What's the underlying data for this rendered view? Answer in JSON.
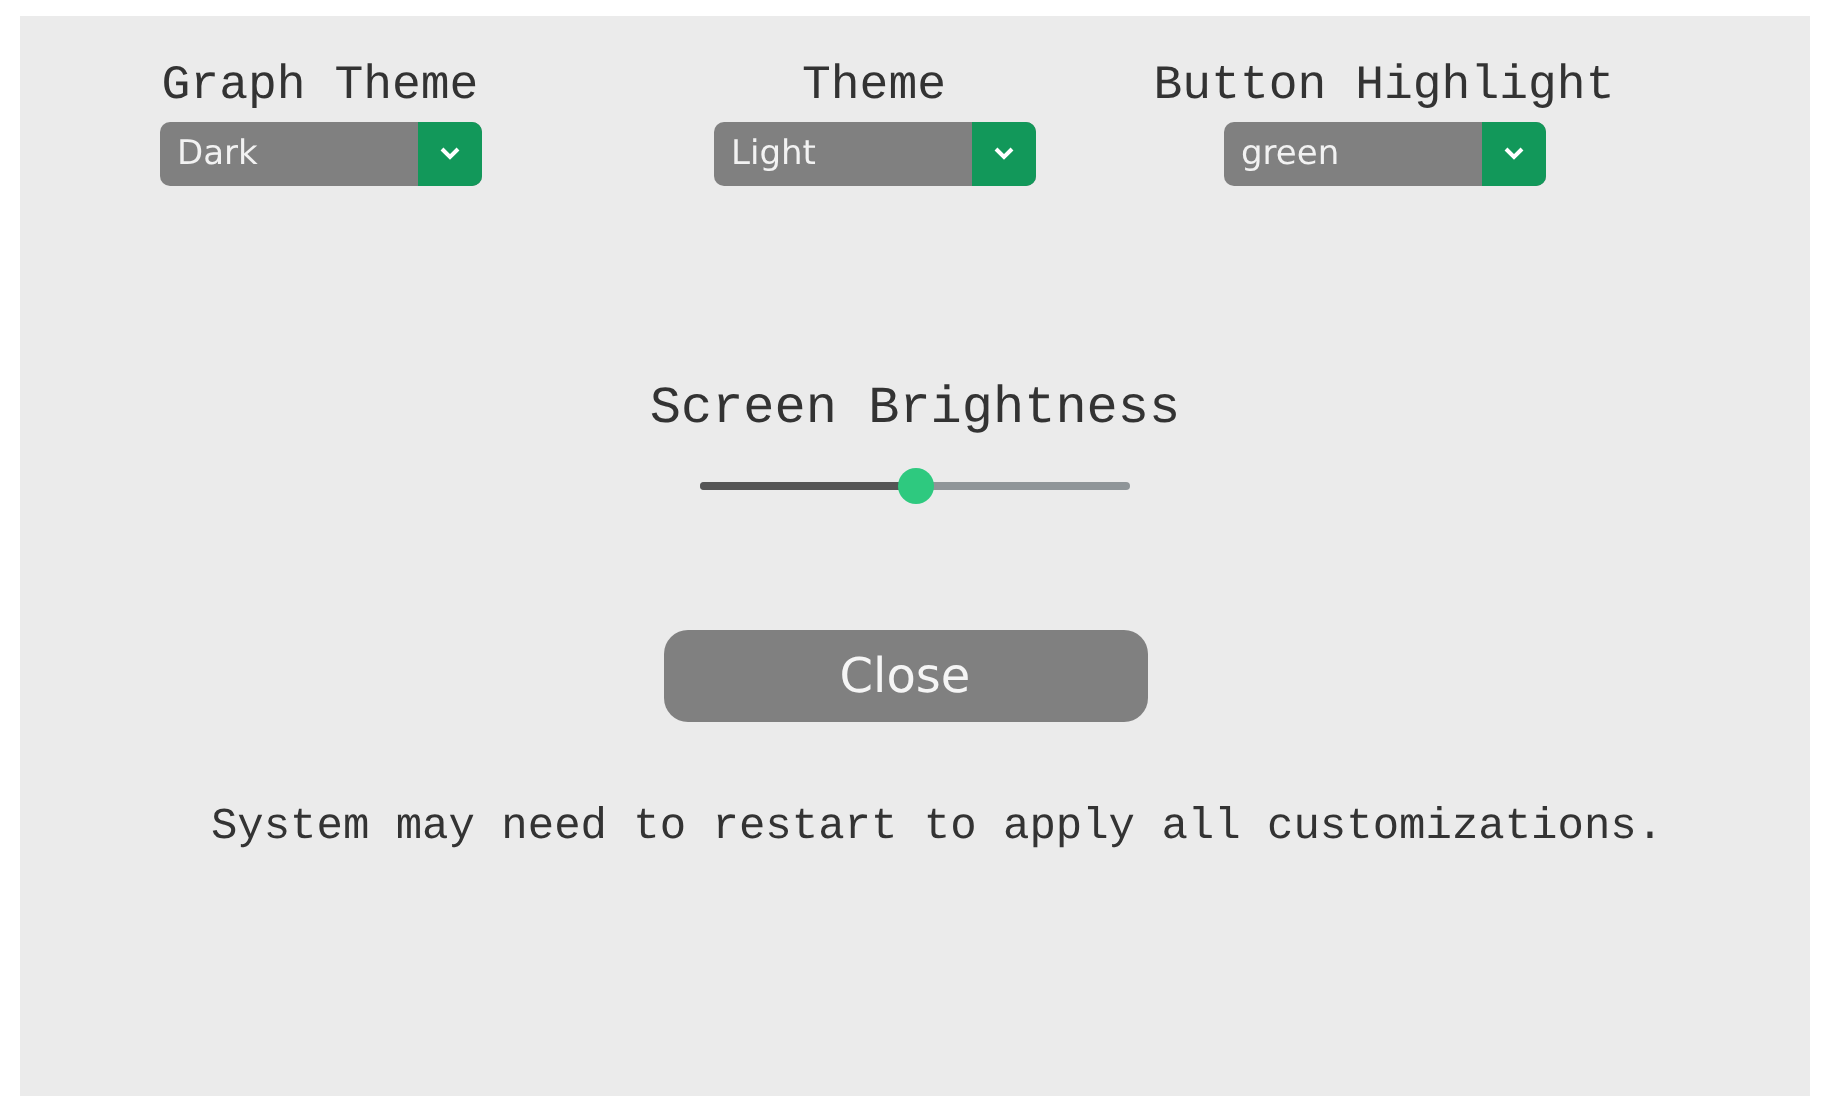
{
  "selectors": [
    {
      "label": "Graph Theme",
      "value": "Dark"
    },
    {
      "label": "Theme",
      "value": "Light"
    },
    {
      "label": "Button Highlight",
      "value": "green"
    }
  ],
  "brightness": {
    "label": "Screen Brightness",
    "level": 0.5
  },
  "close_button": "Close",
  "message": "System may need to restart to apply all customizations."
}
